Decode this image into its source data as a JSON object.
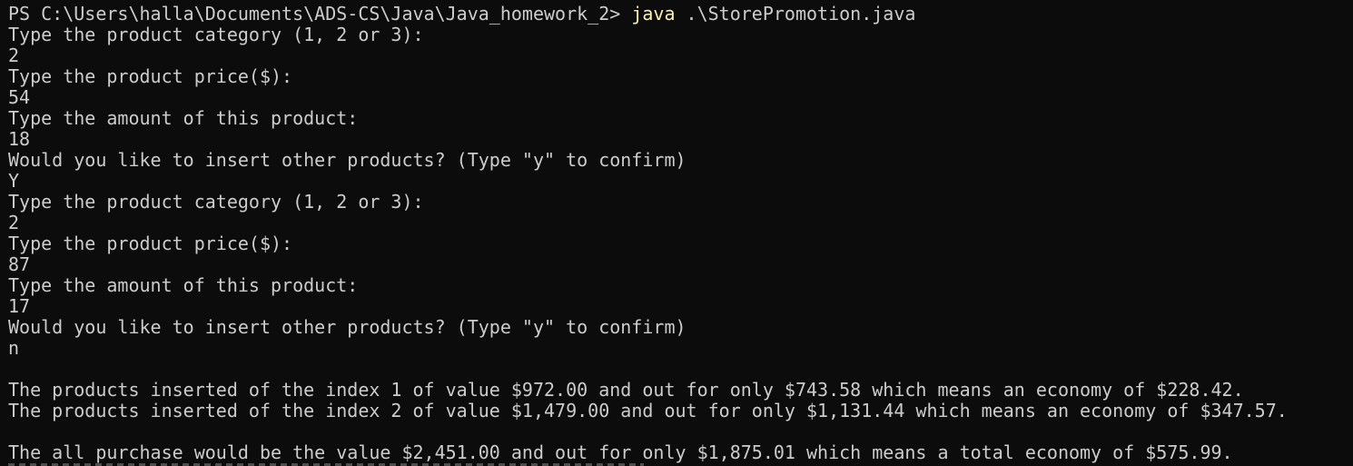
{
  "terminal": {
    "prompt": "PS C:\\Users\\halla\\Documents\\ADS-CS\\Java\\Java_homework_2> ",
    "command": "java",
    "command_args": " .\\StorePromotion.java",
    "lines": [
      "Type the product category (1, 2 or 3):",
      "2",
      "Type the product price($):",
      "54",
      "Type the amount of this product:",
      "18",
      "Would you like to insert other products? (Type \"y\" to confirm)",
      "Y",
      "Type the product category (1, 2 or 3):",
      "2",
      "Type the product price($):",
      "87",
      "Type the amount of this product:",
      "17",
      "Would you like to insert other products? (Type \"y\" to confirm)",
      "n",
      "",
      "The products inserted of the index 1 of value $972.00 and out for only $743.58 which means an economy of $228.42.",
      "The products inserted of the index 2 of value $1,479.00 and out for only $1,131.44 which means an economy of $347.57.",
      "",
      "The all purchase would be the value $2,451.00 and out for only $1,875.01 which means a total economy of $575.99."
    ]
  },
  "colors": {
    "background": "#0c0c0c",
    "foreground": "#cccccc",
    "command": "#f9f1a5"
  }
}
